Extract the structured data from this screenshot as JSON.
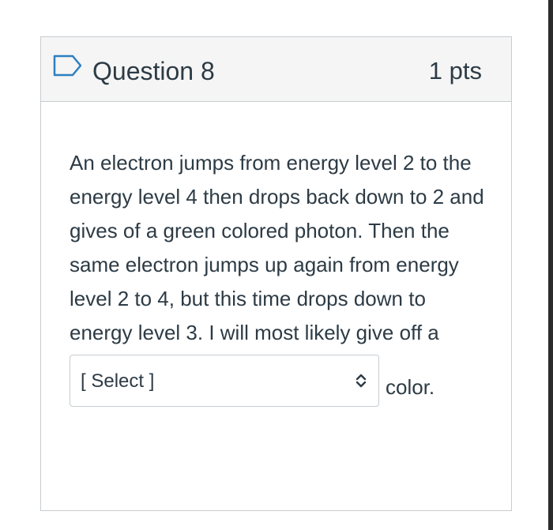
{
  "question": {
    "title": "Question 8",
    "points": "1 pts",
    "text": "An electron jumps from energy level 2 to the energy level 4 then drops back down to 2 and gives of a green colored photon. Then the same electron jumps up again from energy level 2 to 4, but this time drops down to energy level 3. I will most likely give off a",
    "dropdown": {
      "selected": "[ Select ]"
    },
    "suffix": "color."
  },
  "icons": {
    "flag": "bookmark-flag-icon",
    "dropdown": "up-down-chevron-icon"
  },
  "colors": {
    "header_bg": "#f5f5f5",
    "border": "#c7cdd1",
    "text": "#2d3b45",
    "flag_stroke": "#2d7fbf"
  }
}
